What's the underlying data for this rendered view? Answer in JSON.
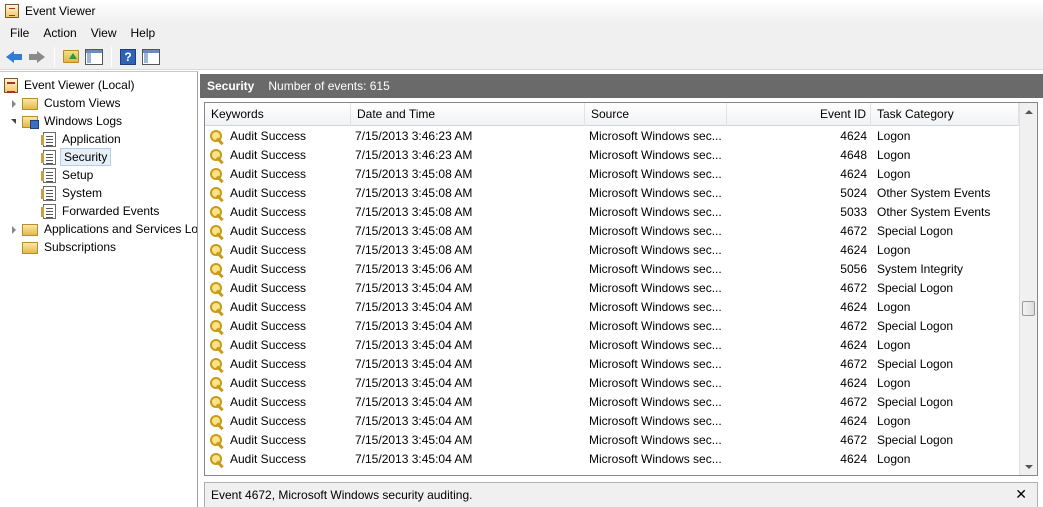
{
  "window": {
    "title": "Event Viewer"
  },
  "menu": [
    "File",
    "Action",
    "View",
    "Help"
  ],
  "toolbar": {
    "icons": [
      "back-arrow-icon",
      "forward-arrow-icon",
      "folder-up-icon",
      "show-hide-tree-icon",
      "help-icon",
      "show-hide-action-pane-icon"
    ],
    "help_glyph": "?"
  },
  "tree": [
    {
      "label": "Event Viewer (Local)",
      "icon": "event-viewer-icon",
      "expander": "none",
      "level": 0
    },
    {
      "label": "Custom Views",
      "icon": "folder-icon",
      "expander": "closed",
      "level": 1
    },
    {
      "label": "Windows Logs",
      "icon": "folder-icon",
      "expander": "open",
      "level": 1
    },
    {
      "label": "Application",
      "icon": "log-icon",
      "expander": "none",
      "level": 2
    },
    {
      "label": "Security",
      "icon": "log-icon",
      "expander": "none",
      "level": 2,
      "selected": true
    },
    {
      "label": "Setup",
      "icon": "log-icon",
      "expander": "none",
      "level": 2
    },
    {
      "label": "System",
      "icon": "log-icon",
      "expander": "none",
      "level": 2
    },
    {
      "label": "Forwarded Events",
      "icon": "log-icon",
      "expander": "none",
      "level": 2
    },
    {
      "label": "Applications and Services Lo",
      "icon": "folder-icon",
      "expander": "closed",
      "level": 1
    },
    {
      "label": "Subscriptions",
      "icon": "folder-icon",
      "expander": "none",
      "level": 1
    }
  ],
  "pane_header": {
    "title": "Security",
    "count": "Number of events: 615"
  },
  "columns": [
    "Keywords",
    "Date and Time",
    "Source",
    "Event ID",
    "Task Category"
  ],
  "rows": [
    [
      "Audit Success",
      "7/15/2013 3:46:23 AM",
      "Microsoft Windows sec...",
      "4624",
      "Logon"
    ],
    [
      "Audit Success",
      "7/15/2013 3:46:23 AM",
      "Microsoft Windows sec...",
      "4648",
      "Logon"
    ],
    [
      "Audit Success",
      "7/15/2013 3:45:08 AM",
      "Microsoft Windows sec...",
      "4624",
      "Logon"
    ],
    [
      "Audit Success",
      "7/15/2013 3:45:08 AM",
      "Microsoft Windows sec...",
      "5024",
      "Other System Events"
    ],
    [
      "Audit Success",
      "7/15/2013 3:45:08 AM",
      "Microsoft Windows sec...",
      "5033",
      "Other System Events"
    ],
    [
      "Audit Success",
      "7/15/2013 3:45:08 AM",
      "Microsoft Windows sec...",
      "4672",
      "Special Logon"
    ],
    [
      "Audit Success",
      "7/15/2013 3:45:08 AM",
      "Microsoft Windows sec...",
      "4624",
      "Logon"
    ],
    [
      "Audit Success",
      "7/15/2013 3:45:06 AM",
      "Microsoft Windows sec...",
      "5056",
      "System Integrity"
    ],
    [
      "Audit Success",
      "7/15/2013 3:45:04 AM",
      "Microsoft Windows sec...",
      "4672",
      "Special Logon"
    ],
    [
      "Audit Success",
      "7/15/2013 3:45:04 AM",
      "Microsoft Windows sec...",
      "4624",
      "Logon"
    ],
    [
      "Audit Success",
      "7/15/2013 3:45:04 AM",
      "Microsoft Windows sec...",
      "4672",
      "Special Logon"
    ],
    [
      "Audit Success",
      "7/15/2013 3:45:04 AM",
      "Microsoft Windows sec...",
      "4624",
      "Logon"
    ],
    [
      "Audit Success",
      "7/15/2013 3:45:04 AM",
      "Microsoft Windows sec...",
      "4672",
      "Special Logon"
    ],
    [
      "Audit Success",
      "7/15/2013 3:45:04 AM",
      "Microsoft Windows sec...",
      "4624",
      "Logon"
    ],
    [
      "Audit Success",
      "7/15/2013 3:45:04 AM",
      "Microsoft Windows sec...",
      "4672",
      "Special Logon"
    ],
    [
      "Audit Success",
      "7/15/2013 3:45:04 AM",
      "Microsoft Windows sec...",
      "4624",
      "Logon"
    ],
    [
      "Audit Success",
      "7/15/2013 3:45:04 AM",
      "Microsoft Windows sec...",
      "4672",
      "Special Logon"
    ],
    [
      "Audit Success",
      "7/15/2013 3:45:04 AM",
      "Microsoft Windows sec...",
      "4624",
      "Logon"
    ]
  ],
  "detail": {
    "text": "Event 4672, Microsoft Windows security auditing.",
    "close_glyph": "✕"
  }
}
